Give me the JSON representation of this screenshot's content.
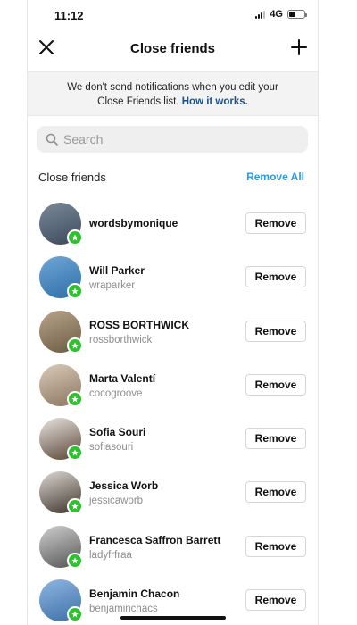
{
  "status_bar": {
    "time": "11:12",
    "network": "4G"
  },
  "header": {
    "title": "Close friends"
  },
  "banner": {
    "text_line1": "We don't send notifications when you edit your",
    "text_line2_prefix": "Close Friends list.",
    "link": "How it works."
  },
  "search": {
    "placeholder": "Search"
  },
  "section": {
    "label": "Close friends",
    "remove_all": "Remove All"
  },
  "friends": [
    {
      "name": "wordsbymonique",
      "username": "",
      "avatar_colors": [
        "#7b8a99",
        "#3a4a5c"
      ]
    },
    {
      "name": "Will Parker",
      "username": "wraparker",
      "avatar_colors": [
        "#6fa6d6",
        "#2f6ea8"
      ]
    },
    {
      "name": "ROSS BORTHWICK",
      "username": "rossborthwick",
      "avatar_colors": [
        "#b8a48a",
        "#6b5a44"
      ]
    },
    {
      "name": "Marta Valentí",
      "username": "cocogroove",
      "avatar_colors": [
        "#d9cbb8",
        "#8a7560"
      ]
    },
    {
      "name": "Sofia Souri",
      "username": "sofiasouri",
      "avatar_colors": [
        "#e8e4e0",
        "#5a4536"
      ]
    },
    {
      "name": "Jessica Worb",
      "username": "jessicaworb",
      "avatar_colors": [
        "#dcd8d2",
        "#3e342c"
      ]
    },
    {
      "name": "Francesca Saffron Barrett",
      "username": "ladyfrfraa",
      "avatar_colors": [
        "#cfcfcf",
        "#555555"
      ]
    },
    {
      "name": "Benjamin Chacon",
      "username": "benjaminchacs",
      "avatar_colors": [
        "#8fb6e0",
        "#3d6fa8"
      ]
    }
  ],
  "remove_label": "Remove",
  "colors": {
    "accent_link": "#2b9be8",
    "badge_green": "#2ec12e",
    "banner_bg": "#f3f3f3"
  }
}
